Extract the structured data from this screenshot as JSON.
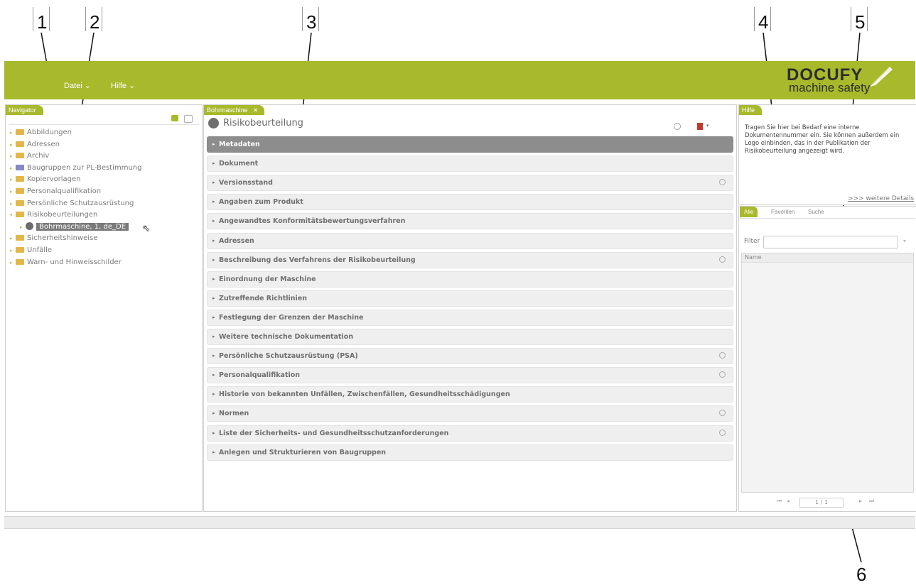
{
  "callouts": [
    "1",
    "2",
    "3",
    "4",
    "5",
    "6"
  ],
  "menu": {
    "file": "Datei ⌄",
    "help": "Hilfe ⌄"
  },
  "logo": {
    "main": "DOCUFY",
    "sub": "machine safety"
  },
  "navigator": {
    "tab": "Navigator",
    "items": [
      {
        "label": "Abbildungen",
        "folder": "yellow"
      },
      {
        "label": "Adressen",
        "folder": "yellow"
      },
      {
        "label": "Archiv",
        "folder": "yellow"
      },
      {
        "label": "Baugruppen zur PL-Bestimmung",
        "folder": "blue"
      },
      {
        "label": "Kopiervorlagen",
        "folder": "yellow"
      },
      {
        "label": "Personalqualifikation",
        "folder": "yellow"
      },
      {
        "label": "Persönliche Schutzausrüstung",
        "folder": "yellow"
      },
      {
        "label": "Risikobeurteilungen",
        "folder": "yellow"
      },
      {
        "label": "Sicherheitshinweise",
        "folder": "yellow"
      },
      {
        "label": "Unfälle",
        "folder": "yellow"
      },
      {
        "label": "Warn- und Hinweisschilder",
        "folder": "yellow"
      }
    ],
    "selected_child": "Bohrmaschine, 1, de_DE"
  },
  "center": {
    "tab": "Bohrmaschine",
    "title": "Risikobeurteilung",
    "sections": [
      {
        "label": "Metadaten",
        "active": true,
        "search": false
      },
      {
        "label": "Dokument",
        "active": false,
        "search": false
      },
      {
        "label": "Versionsstand",
        "active": false,
        "search": true
      },
      {
        "label": "Angaben zum Produkt",
        "active": false,
        "search": false
      },
      {
        "label": "Angewandtes Konformitätsbewertungsverfahren",
        "active": false,
        "search": false
      },
      {
        "label": "Adressen",
        "active": false,
        "search": false
      },
      {
        "label": "Beschreibung des Verfahrens der Risikobeurteilung",
        "active": false,
        "search": true
      },
      {
        "label": "Einordnung der Maschine",
        "active": false,
        "search": false
      },
      {
        "label": "Zutreffende Richtlinien",
        "active": false,
        "search": false
      },
      {
        "label": "Festlegung der Grenzen der Maschine",
        "active": false,
        "search": false
      },
      {
        "label": "Weitere technische Dokumentation",
        "active": false,
        "search": false
      },
      {
        "label": "Persönliche Schutzausrüstung (PSA)",
        "active": false,
        "search": true
      },
      {
        "label": "Personalqualifikation",
        "active": false,
        "search": true
      },
      {
        "label": "Historie von bekannten Unfällen, Zwischenfällen, Gesundheitsschädigungen",
        "active": false,
        "search": false
      },
      {
        "label": "Normen",
        "active": false,
        "search": true
      },
      {
        "label": "Liste der Sicherheits- und Gesundheitsschutzanforderungen",
        "active": false,
        "search": true
      },
      {
        "label": "Anlegen und Strukturieren von Baugruppen",
        "active": false,
        "search": false
      }
    ]
  },
  "help": {
    "tab": "Hilfe",
    "text": "Tragen Sie hier bei Bedarf eine interne Dokumentennummer ein. Sie können außerdem ein Logo einbinden, das in der Publikation der Risikobeurteilung angezeigt wird.",
    "link": ">>> weitere Details"
  },
  "lower": {
    "tabs": [
      "Alle",
      "Favoriten",
      "Suche"
    ],
    "filter_label": "Filter",
    "column": "Name",
    "pager": "1 / 1"
  },
  "colors": {
    "accent": "#a8b92c"
  }
}
